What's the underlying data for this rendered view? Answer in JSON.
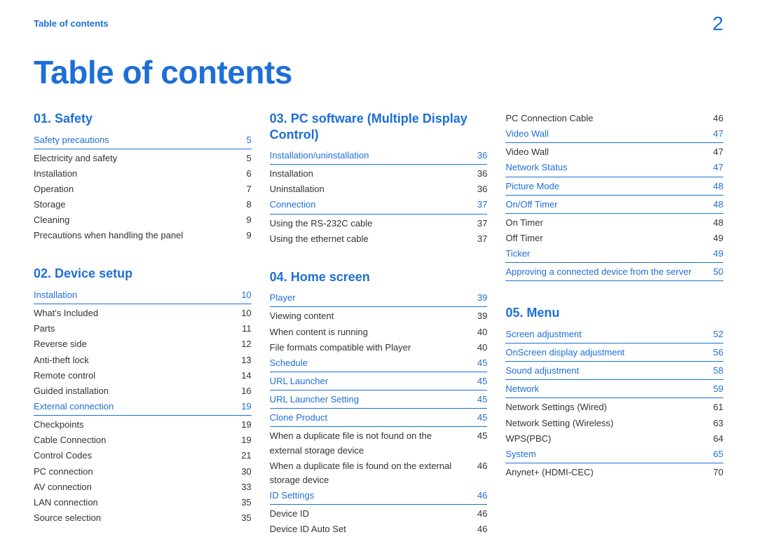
{
  "header": {
    "breadcrumb": "Table of contents",
    "pageNumber": "2"
  },
  "title": "Table of contents",
  "col1": {
    "sectionA": {
      "heading": "01. Safety",
      "rows": [
        {
          "label": "Safety precautions",
          "page": "5",
          "type": "link-under"
        },
        {
          "label": "Electricity and safety",
          "page": "5",
          "type": "sub"
        },
        {
          "label": "Installation",
          "page": "6",
          "type": "sub"
        },
        {
          "label": "Operation",
          "page": "7",
          "type": "sub"
        },
        {
          "label": "Storage",
          "page": "8",
          "type": "sub"
        },
        {
          "label": "Cleaning",
          "page": "9",
          "type": "sub"
        },
        {
          "label": "Precautions when handling the panel",
          "page": "9",
          "type": "sub"
        }
      ]
    },
    "sectionB": {
      "heading": "02. Device setup",
      "rows": [
        {
          "label": "Installation",
          "page": "10",
          "type": "link-under"
        },
        {
          "label": "What's Included",
          "page": "10",
          "type": "sub"
        },
        {
          "label": "Parts",
          "page": "11",
          "type": "sub"
        },
        {
          "label": "Reverse side",
          "page": "12",
          "type": "sub"
        },
        {
          "label": "Anti-theft lock",
          "page": "13",
          "type": "sub"
        },
        {
          "label": "Remote control",
          "page": "14",
          "type": "sub"
        },
        {
          "label": "Guided installation",
          "page": "16",
          "type": "sub"
        },
        {
          "label": "External connection",
          "page": "19",
          "type": "link-under"
        },
        {
          "label": "Checkpoints",
          "page": "19",
          "type": "sub"
        },
        {
          "label": "Cable Connection",
          "page": "19",
          "type": "sub"
        },
        {
          "label": "Control Codes",
          "page": "21",
          "type": "sub"
        },
        {
          "label": "PC connection",
          "page": "30",
          "type": "sub"
        },
        {
          "label": "AV connection",
          "page": "33",
          "type": "sub"
        },
        {
          "label": "LAN connection",
          "page": "35",
          "type": "sub"
        },
        {
          "label": "Source selection",
          "page": "35",
          "type": "sub"
        }
      ]
    }
  },
  "col2": {
    "sectionA": {
      "heading": "03. PC software (Multiple Display Control)",
      "rows": [
        {
          "label": "Installation/uninstallation",
          "page": "36",
          "type": "link-under"
        },
        {
          "label": "Installation",
          "page": "36",
          "type": "sub"
        },
        {
          "label": "Uninstallation",
          "page": "36",
          "type": "sub"
        },
        {
          "label": "Connection",
          "page": "37",
          "type": "link-under"
        },
        {
          "label": "Using the RS-232C cable",
          "page": "37",
          "type": "sub"
        },
        {
          "label": "Using the ethernet cable",
          "page": "37",
          "type": "sub"
        }
      ]
    },
    "sectionB": {
      "heading": "04. Home screen",
      "rows": [
        {
          "label": "Player",
          "page": "39",
          "type": "link-under"
        },
        {
          "label": "Viewing content",
          "page": "39",
          "type": "sub"
        },
        {
          "label": "When content is running",
          "page": "40",
          "type": "sub"
        },
        {
          "label": "File formats compatible with Player",
          "page": "40",
          "type": "sub"
        },
        {
          "label": "Schedule",
          "page": "45",
          "type": "link-under"
        },
        {
          "label": "URL Launcher",
          "page": "45",
          "type": "link-under"
        },
        {
          "label": "URL Launcher Setting",
          "page": "45",
          "type": "link-under"
        },
        {
          "label": "Clone Product",
          "page": "45",
          "type": "link-under"
        },
        {
          "label": "When a duplicate file is not found on the external storage device",
          "page": "45",
          "type": "sub"
        },
        {
          "label": "When a duplicate file is found on the external storage device",
          "page": "46",
          "type": "sub"
        },
        {
          "label": "ID Settings",
          "page": "46",
          "type": "link-under"
        },
        {
          "label": "Device ID",
          "page": "46",
          "type": "sub"
        },
        {
          "label": "Device ID Auto Set",
          "page": "46",
          "type": "sub"
        }
      ]
    }
  },
  "col3": {
    "topRows": [
      {
        "label": "PC Connection Cable",
        "page": "46",
        "type": "sub"
      },
      {
        "label": "Video Wall",
        "page": "47",
        "type": "link-under"
      },
      {
        "label": "Video Wall",
        "page": "47",
        "type": "sub"
      },
      {
        "label": "Network Status",
        "page": "47",
        "type": "link-under"
      },
      {
        "label": "Picture Mode",
        "page": "48",
        "type": "link-under"
      },
      {
        "label": "On/Off Timer",
        "page": "48",
        "type": "link-under"
      },
      {
        "label": "On Timer",
        "page": "48",
        "type": "sub"
      },
      {
        "label": "Off Timer",
        "page": "49",
        "type": "sub"
      },
      {
        "label": "Ticker",
        "page": "49",
        "type": "link-under"
      },
      {
        "label": "Approving a connected device from the server",
        "page": "50",
        "type": "link-under"
      }
    ],
    "sectionB": {
      "heading": "05. Menu",
      "rows": [
        {
          "label": "Screen adjustment",
          "page": "52",
          "type": "link-under"
        },
        {
          "label": "OnScreen display adjustment",
          "page": "56",
          "type": "link-under"
        },
        {
          "label": "Sound adjustment",
          "page": "58",
          "type": "link-under"
        },
        {
          "label": "Network",
          "page": "59",
          "type": "link-under"
        },
        {
          "label": "Network Settings (Wired)",
          "page": "61",
          "type": "sub"
        },
        {
          "label": "Network Setting (Wireless)",
          "page": "63",
          "type": "sub"
        },
        {
          "label": "WPS(PBC)",
          "page": "64",
          "type": "sub"
        },
        {
          "label": "System",
          "page": "65",
          "type": "link-under"
        },
        {
          "label": "Anynet+ (HDMI-CEC)",
          "page": "70",
          "type": "sub"
        }
      ]
    }
  }
}
